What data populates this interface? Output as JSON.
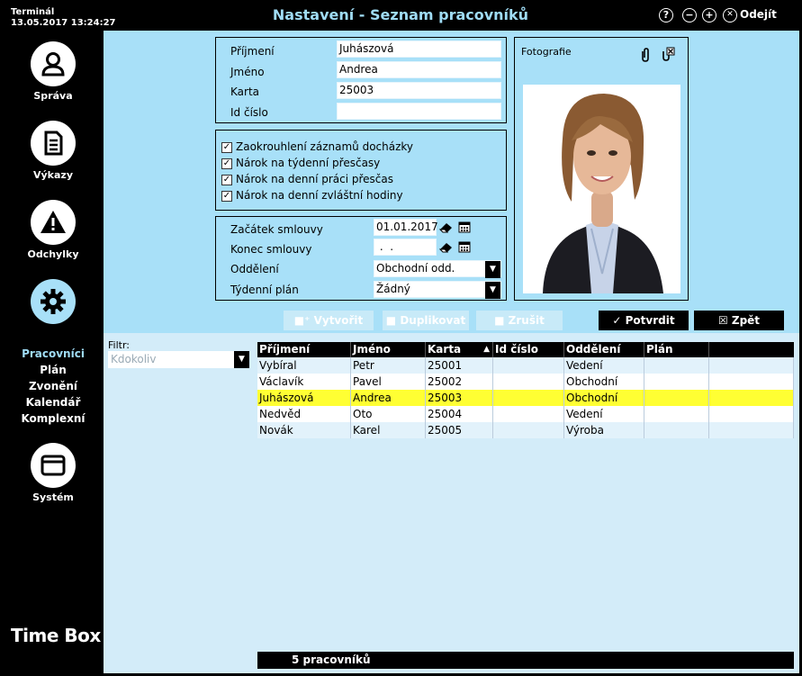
{
  "header": {
    "terminal_label": "Terminál",
    "datetime": "13.05.2017 13:24:27",
    "title": "Nastavení - Seznam pracovníků",
    "help_glyph": "?",
    "minus_glyph": "−",
    "plus_glyph": "+",
    "close_glyph": "✕",
    "quit_label": "Odejít"
  },
  "sidebar": {
    "nav": [
      {
        "label": "Správa",
        "icon": "user-icon"
      },
      {
        "label": "Výkazy",
        "icon": "document-icon"
      },
      {
        "label": "Odchylky",
        "icon": "warning-icon"
      },
      {
        "label": "",
        "icon": "gear-icon"
      },
      {
        "label": "Systém",
        "icon": "window-icon"
      }
    ],
    "sub_items": [
      "Pracovníci",
      "Plán",
      "Zvonění",
      "Kalendář",
      "Komplexní"
    ],
    "active_sub_color": "#9fdcf5",
    "brand": "Time Box"
  },
  "form": {
    "surname_label": "Příjmení",
    "surname_value": "Juhászová",
    "name_label": "Jméno",
    "name_value": "Andrea",
    "card_label": "Karta",
    "card_value": "25003",
    "id_label": "Id číslo",
    "id_value": "",
    "checks": [
      {
        "label": "Zaokrouhlení záznamů docházky",
        "checked": "✓"
      },
      {
        "label": "Nárok na týdenní přesčasy",
        "checked": "✓"
      },
      {
        "label": "Nárok na denní práci přesčas",
        "checked": "✓"
      },
      {
        "label": "Nárok na denní zvláštní hodiny",
        "checked": "✓"
      }
    ],
    "contract_start_label": "Začátek smlouvy",
    "contract_start_value": "01.01.2017",
    "contract_end_label": "Konec smlouvy",
    "contract_end_value": " .  .",
    "department_label": "Oddělení",
    "department_value": "Obchodní odd.",
    "weekly_plan_label": "Týdenní plán",
    "weekly_plan_value": "Žádný"
  },
  "photo": {
    "label": "Fotografie"
  },
  "actions": {
    "create": "Vytvořit",
    "duplicate": "Duplikovat",
    "cancel": "Zrušit",
    "confirm": "Potvrdit",
    "back": "Zpět"
  },
  "filter": {
    "label": "Filtr:",
    "placeholder": "Kdokoliv"
  },
  "table": {
    "columns": [
      "Příjmení",
      "Jméno",
      "Karta",
      "Id číslo",
      "Oddělení",
      "Plán"
    ],
    "sort_indicator": "▲",
    "rows": [
      {
        "surname": "Vybíral",
        "name": "Petr",
        "card": "25001",
        "id": "",
        "dept": "Vedení",
        "plan": ""
      },
      {
        "surname": "Václavík",
        "name": "Pavel",
        "card": "25002",
        "id": "",
        "dept": "Obchodní odd.",
        "plan": ""
      },
      {
        "surname": "Juhászová",
        "name": "Andrea",
        "card": "25003",
        "id": "",
        "dept": "Obchodní odd.",
        "plan": ""
      },
      {
        "surname": "Nedvěd",
        "name": "Oto",
        "card": "25004",
        "id": "",
        "dept": "Vedení",
        "plan": ""
      },
      {
        "surname": "Novák",
        "name": "Karel",
        "card": "25005",
        "id": "",
        "dept": "Výroba",
        "plan": ""
      }
    ],
    "selected_row": 2,
    "selected_color": "#ffff33",
    "status": "5 pracovníků"
  }
}
